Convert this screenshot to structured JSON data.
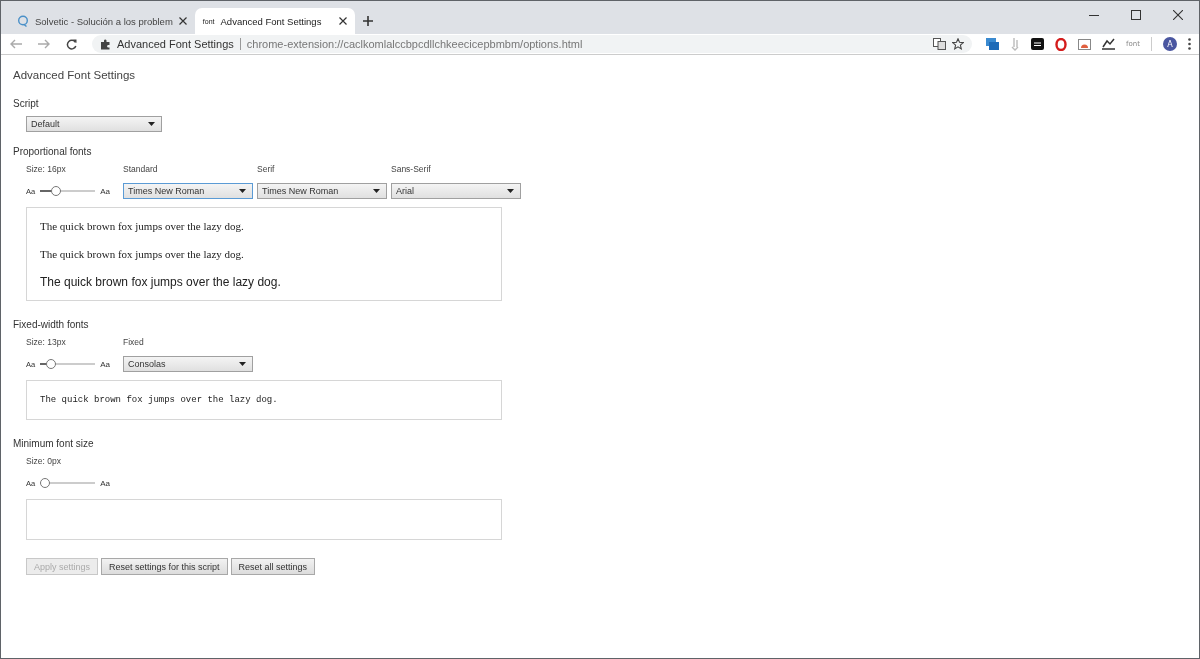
{
  "tabs": [
    {
      "title": "Solvetic - Solución a los problem",
      "kind": "site",
      "selected": false
    },
    {
      "title": "Advanced Font Settings",
      "kind": "extension",
      "icon_text": "font",
      "selected": true
    }
  ],
  "toolbar": {
    "page_title": "Advanced Font Settings",
    "url": "chrome-extension://caclkomlalccbpcdllchkeecicepbmbm/options.html",
    "extension_label": "font",
    "avatar": "A"
  },
  "page": {
    "title": "Advanced Font Settings",
    "script": {
      "label": "Script",
      "value": "Default"
    },
    "sections": [
      {
        "heading": "Proportional fonts",
        "size": "Size: 16px",
        "level": 0.25,
        "small_aa": "Aa",
        "large_aa": "Aa",
        "selects": [
          {
            "label": "Standard",
            "value": "Times New Roman",
            "focused": true
          },
          {
            "label": "Serif",
            "value": "Times New Roman",
            "focused": false
          },
          {
            "label": "Sans-Serif",
            "value": "Arial",
            "focused": false
          }
        ],
        "samples": [
          {
            "text": "The quick brown fox jumps over the lazy dog.",
            "kind": "serif"
          },
          {
            "text": "The quick brown fox jumps over the lazy dog.",
            "kind": "serif"
          },
          {
            "text": "The quick brown fox jumps over the lazy dog.",
            "kind": "sans"
          }
        ]
      },
      {
        "heading": "Fixed-width fonts",
        "size": "Size: 13px",
        "level": 0.12,
        "small_aa": "Aa",
        "large_aa": "Aa",
        "selects": [
          {
            "label": "Fixed",
            "value": "Consolas",
            "focused": false
          }
        ],
        "samples": [
          {
            "text": "The quick brown fox jumps over the lazy dog.",
            "kind": "mono"
          }
        ]
      },
      {
        "heading": "Minimum font size",
        "size": "Size: 0px",
        "level": 0,
        "small_aa": "Aa",
        "large_aa": "Aa"
      }
    ],
    "buttons": [
      {
        "label": "Apply settings",
        "disabled": true
      },
      {
        "label": "Reset settings for this script",
        "disabled": false
      },
      {
        "label": "Reset all settings",
        "disabled": false
      }
    ]
  }
}
